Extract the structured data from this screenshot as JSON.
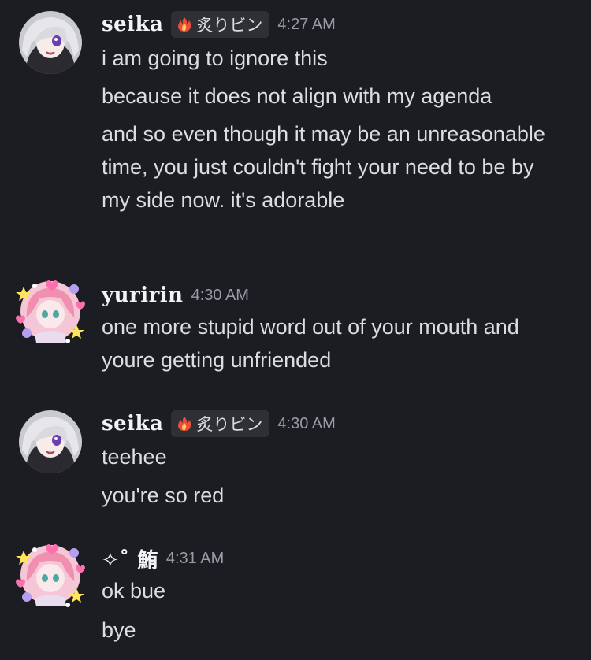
{
  "messages": [
    {
      "username": "seika",
      "role_tag": "炙りビン",
      "tag_icon": "fire-icon",
      "timestamp": "4:27 AM",
      "lines": [
        "i am going to ignore this",
        "because it does not align with my agenda",
        "and so even though it may be an unreasonable time, you just couldn't fight your need to be by my side now. it's adorable"
      ]
    },
    {
      "username": "yuririn",
      "timestamp": "4:30 AM",
      "lines": [
        "one more stupid word out of your mouth and youre getting unfriended"
      ]
    },
    {
      "username": "seika",
      "role_tag": "炙りビン",
      "tag_icon": "fire-icon",
      "timestamp": "4:30 AM",
      "lines": [
        "teehee",
        "you're so red"
      ]
    },
    {
      "username": "✧˚ 鮪",
      "timestamp": "4:31 AM",
      "lines": [
        "ok bue",
        "bye"
      ]
    }
  ],
  "colors": {
    "background": "#1c1d22",
    "text": "#dbdee1",
    "username": "#f2f3f5",
    "timestamp": "#9a9ca4",
    "tag_background": "#2e3036"
  }
}
